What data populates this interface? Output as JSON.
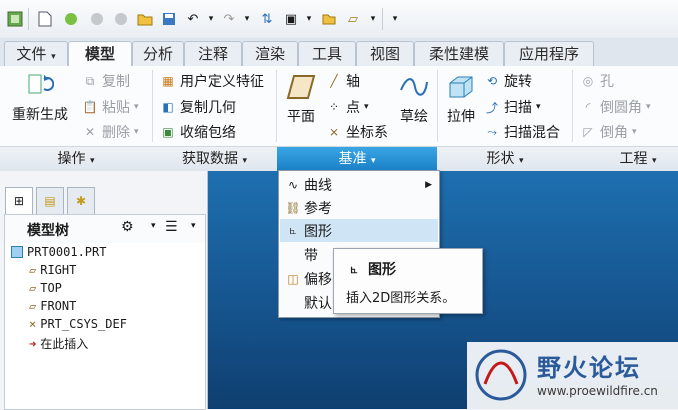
{
  "ribbon_tabs": [
    "文件",
    "模型",
    "分析",
    "注释",
    "渲染",
    "工具",
    "视图",
    "柔性建模",
    "应用程序"
  ],
  "ops": {
    "regen": "重新生成",
    "copy": "复制",
    "paste": "粘贴",
    "delete": "删除"
  },
  "get_data": {
    "udf": "用户定义特征",
    "copy_geom": "复制几何",
    "shrinkwrap": "收缩包络"
  },
  "datum": {
    "plane": "平面",
    "axis": "轴",
    "point": "点",
    "csys": "坐标系",
    "sketch": "草绘"
  },
  "shapes": {
    "extrude": "拉伸",
    "revolve": "旋转",
    "sweep": "扫描",
    "swept_blend": "扫描混合"
  },
  "engineering": {
    "hole": "孔",
    "round": "倒圆角",
    "chamfer": "倒角"
  },
  "groups": {
    "ops": "操作",
    "getdata": "获取数据",
    "datum": "基准",
    "shapes": "形状",
    "eng": "工程"
  },
  "model_tree": {
    "title": "模型树",
    "items": [
      "PRT0001.PRT",
      "RIGHT",
      "TOP",
      "FRONT",
      "PRT_CSYS_DEF",
      "在此插入"
    ]
  },
  "datum_menu": {
    "curve": "曲线",
    "reference": "参考",
    "graph": "图形",
    "ribbon_trunc": "带",
    "offset_trunc": "偏移",
    "default_trunc": "默认"
  },
  "tooltip": {
    "title": "图形",
    "desc": "插入2D图形关系。"
  },
  "watermark": {
    "name": "野火论坛",
    "url": "www.proewildfire.cn"
  },
  "colors": {
    "accent_blue": "#1a7fc6",
    "viewport_blue": "#16558f"
  }
}
